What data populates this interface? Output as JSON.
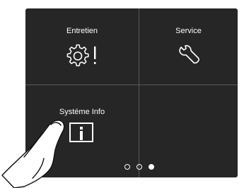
{
  "tiles": [
    {
      "label": "Entretien",
      "icon": "maintenance-gear-icon"
    },
    {
      "label": "Service",
      "icon": "wrench-icon"
    },
    {
      "label": "Systéme Info",
      "icon": "info-icon"
    },
    {
      "label": "",
      "icon": ""
    }
  ],
  "pager": {
    "pages": 3,
    "active": 3
  },
  "colors": {
    "screen_bg": "#262626",
    "divider": "#5a5a5a",
    "foreground": "#ffffff"
  }
}
